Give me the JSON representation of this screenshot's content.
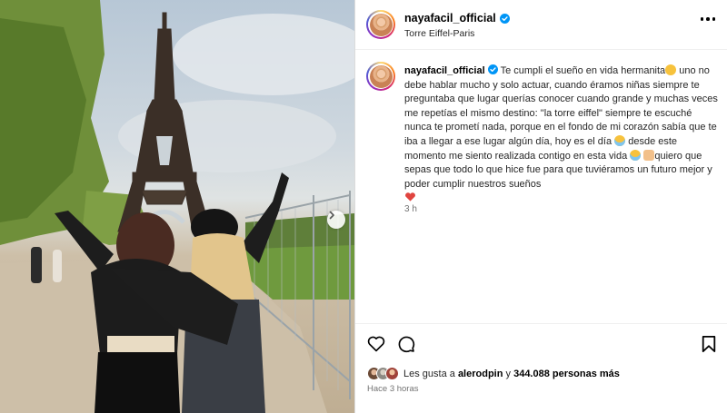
{
  "post": {
    "username": "nayafacil_official",
    "location": "Torre Eiffel-Paris",
    "caption": {
      "username": "nayafacil_official",
      "lines": [
        " Te cumpli el sueño en vida hermanita",
        " uno no debe hablar mucho y solo actuar, cuando éramos niñas siempre te preguntaba que lugar querías conocer cuando grande y muchas veces me repetías el mismo destino: \"la torre eiffel\" siempre te escuché nunca te prometí nada, porque en el fondo de mi corazón sabía que te iba a llegar a ese lugar algún día, hoy es el día",
        " desde este momento me siento realizada contigo en esta vida ",
        "quiero que sepas que todo lo que hice fue para que tuviéramos un futuro mejor y poder cumplir nuestros sueños"
      ],
      "time": "3 h"
    },
    "likes": {
      "prefix": "Les gusta a ",
      "first_user": "alerodpin",
      "connector": " y ",
      "count": "344.088 personas más"
    },
    "posted_ago": "Hace 3 horas"
  },
  "icons": {
    "verified": "verified-badge-icon",
    "more": "more-options-icon",
    "like": "heart-icon",
    "comment": "comment-icon",
    "save": "bookmark-icon",
    "next": "chevron-right-icon"
  },
  "colors": {
    "verified": "#0095f6",
    "muted_text": "#737373",
    "border": "#dbdbdb"
  }
}
